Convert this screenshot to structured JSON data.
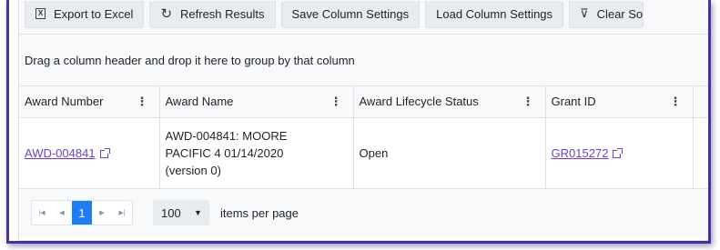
{
  "toolbar": {
    "export_label": "Export to Excel",
    "refresh_label": "Refresh Results",
    "save_columns_label": "Save Column Settings",
    "load_columns_label": "Load Column Settings",
    "clear_label": "Clear So"
  },
  "grouping": {
    "hint": "Drag a column header and drop it here to group by that column"
  },
  "columns": [
    {
      "label": "Award Number"
    },
    {
      "label": "Award Name"
    },
    {
      "label": "Award Lifecycle Status"
    },
    {
      "label": "Grant ID"
    }
  ],
  "rows": [
    {
      "award_number": "AWD-004841",
      "award_name_line1": "AWD-004841: MOORE",
      "award_name_line2": "PACIFIC 4 01/14/2020",
      "award_name_line3": "(version 0)",
      "status": "Open",
      "grant_id": "GR015272"
    }
  ],
  "pager": {
    "current_page": "1",
    "page_size": "100",
    "items_per_page_label": "items per page"
  },
  "icons": {
    "export": "excel-icon",
    "refresh": "refresh-icon",
    "clear": "filter-clear-icon",
    "column_menu": "kebab-menu-icon",
    "external_link": "external-link-icon"
  },
  "colors": {
    "frame_border": "#4a2fa0",
    "link": "#6f42c1",
    "active_page": "#1e7cf5"
  }
}
